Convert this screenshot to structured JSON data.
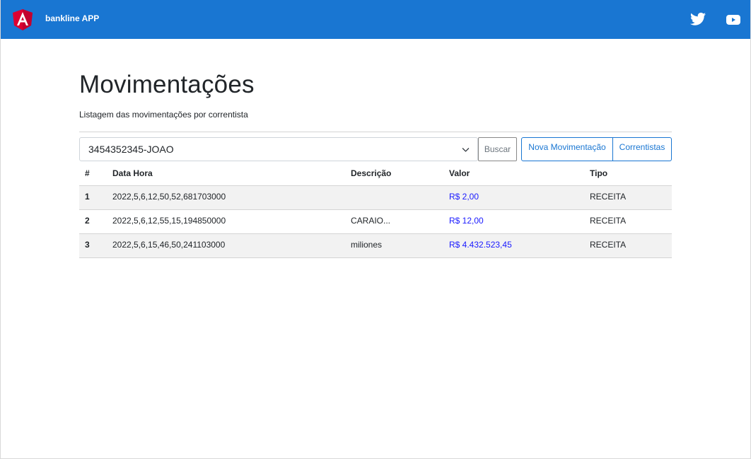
{
  "app": {
    "brand": "bankline APP",
    "icons": {
      "logo": "angular-logo-icon",
      "twitter": "twitter-icon",
      "youtube": "youtube-icon"
    },
    "colors": {
      "navbar": "#1976d2",
      "accent": "#1976d2",
      "value": "#1a1aff"
    }
  },
  "page": {
    "title": "Movimentações",
    "subtitle": "Listagem das movimentações por correntista"
  },
  "controls": {
    "correntista_selected": "3454352345-JOAO",
    "search_label": "Buscar",
    "new_label": "Nova Movimentação",
    "correntistas_label": "Correntistas"
  },
  "table": {
    "headers": [
      "#",
      "Data Hora",
      "Descrição",
      "Valor",
      "Tipo"
    ],
    "rows": [
      {
        "id": "1",
        "datahora": "2022,5,6,12,50,52,681703000",
        "descricao": "",
        "valor": "R$ 2,00",
        "tipo": "RECEITA"
      },
      {
        "id": "2",
        "datahora": "2022,5,6,12,55,15,194850000",
        "descricao": "CARAIO...",
        "valor": "R$ 12,00",
        "tipo": "RECEITA"
      },
      {
        "id": "3",
        "datahora": "2022,5,6,15,46,50,241103000",
        "descricao": "miliones",
        "valor": "R$ 4.432.523,45",
        "tipo": "RECEITA"
      }
    ]
  }
}
